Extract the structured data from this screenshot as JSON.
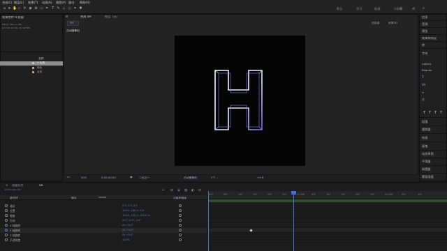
{
  "menu": [
    "合成(C)",
    "图层(L)",
    "效果(T)",
    "动画(A)",
    "视图(V)",
    "窗口",
    "帮助(H)"
  ],
  "workspaces": [
    "默认",
    "学习",
    "标准",
    "小屏幕",
    "库"
  ],
  "project": {
    "header": "效果控件 H 轮廓",
    "info_line1": "640 x 360 (1.00)",
    "info_line2": "Δ 0:00:10:00, 30.00 fps",
    "col_name": "名称",
    "items": [
      {
        "label": "H 轮廓",
        "color": "#c8c8c8"
      },
      {
        "label": "纯色",
        "color": "#c8a07a"
      },
      {
        "label": "合成",
        "color": "#c8a07a"
      }
    ]
  },
  "comp": {
    "tab_label": "合成 SH",
    "tab_menu": "≡",
    "layer_label": "图层（无）",
    "breadcrumb": "SH",
    "active_camera": "活动摄像机",
    "renderer": "渲染器",
    "renderer_value": "经典3D",
    "bottom_zoom": "50%",
    "bottom_time": "0:00:00:00",
    "bottom_res": "二分之一",
    "bottom_cam": "活动摄像机",
    "bottom_views": "1个…",
    "bottom_offset": "+0.0"
  },
  "canvas_letter": "H",
  "right_panel": [
    "信息",
    "音频",
    "预览",
    "效果和预设",
    "库",
    "字符",
    "Gallery",
    "Regular",
    "段落",
    "跟踪器",
    "绘画",
    "画笔",
    "动态草图",
    "平滑器",
    "摇摆器",
    "蒙版插值"
  ],
  "timeline": {
    "tab_render": "渲染队列",
    "tab_comp": "SH",
    "current_time": "0:00:00:00",
    "col_source": "源名称",
    "col_mode": "模式",
    "col_trkmat": "TrkMat",
    "col_parent": "父级和链接",
    "layers": [
      {
        "name": "锚点",
        "value": "0.0, 0.0, 0.0"
      },
      {
        "name": "位置",
        "value": "320.0, 180.0, 0.0"
      },
      {
        "name": "缩放",
        "value": "100.0, 100.0, 100.0 %"
      },
      {
        "name": "方向",
        "value": "0.0°, 0.0°, 0.0°"
      },
      {
        "name": "X 轴旋转",
        "value": "0x +0.0°"
      },
      {
        "name": "Y 轴旋转",
        "value": "0x +0.0°"
      },
      {
        "name": "Z 轴旋转",
        "value": "0x +0.0°"
      },
      {
        "name": "不透明度",
        "value": "100%"
      }
    ],
    "ruler": [
      "00f",
      "05f",
      "10f",
      "15f",
      "20f",
      "25f",
      "01:00f",
      "05f",
      "10f",
      "15f",
      "20f",
      "25f",
      "02:00f",
      "05f",
      "10f"
    ]
  },
  "colors": {
    "accent": "#4a7ad2",
    "playhead": "#3d73d9",
    "canvas": "#050505"
  }
}
